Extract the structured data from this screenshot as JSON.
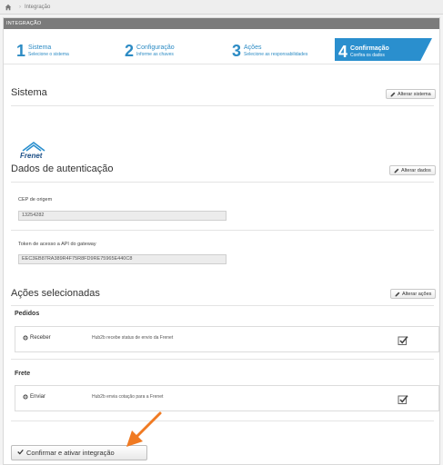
{
  "breadcrumb": {
    "current": "Integração"
  },
  "panel": {
    "header": "INTEGRAÇÃO"
  },
  "wizard": {
    "steps": [
      {
        "number": "1",
        "title": "Sistema",
        "subtitle": "Selecione o sistema"
      },
      {
        "number": "2",
        "title": "Configuração",
        "subtitle": "Informe as chaves"
      },
      {
        "number": "3",
        "title": "Ações",
        "subtitle": "Selecione as responsabilidades"
      },
      {
        "number": "4",
        "title": "Confirmação",
        "subtitle": "Confira os dados"
      }
    ]
  },
  "sistema": {
    "title": "Sistema",
    "change_label": "Alterar sistema",
    "logo_text": "Frenet"
  },
  "auth": {
    "title": "Dados de autenticação",
    "change_label": "Alterar dados",
    "cep_label": "CEP de origem",
    "cep_value": "13254282",
    "token_label": "Token de acesso a API do gateway",
    "token_value": "EEC3EB87RA389R4F75R8FD9RE75965E440C8"
  },
  "acoes": {
    "title": "Ações selecionadas",
    "change_label": "Alterar ações",
    "groups": [
      {
        "name": "Pedidos",
        "action": "Receber",
        "description": "Hub2b recebe status de envio da Frenet"
      },
      {
        "name": "Frete",
        "action": "Enviar",
        "description": "Hub2b envia cotação para a Frenet"
      }
    ]
  },
  "confirm": {
    "label": "Confirmar e ativar integração"
  },
  "colors": {
    "accent": "#2a8fce",
    "header": "#7b7b7b",
    "arrow": "#f07a22"
  }
}
